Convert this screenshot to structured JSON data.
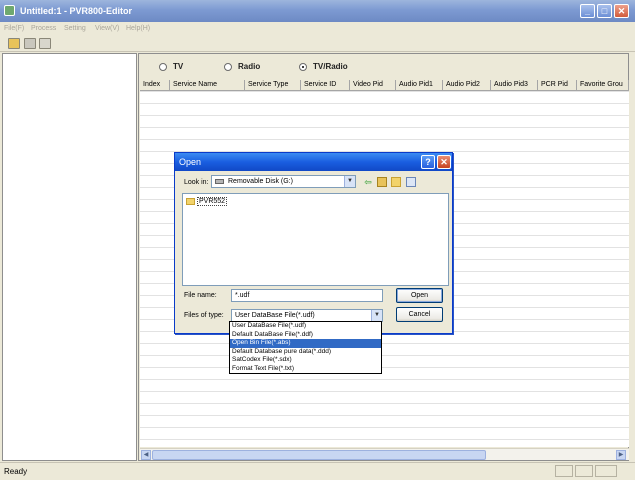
{
  "window": {
    "title": "Untitled:1 - PVR800-Editor",
    "minimize": "_",
    "maximize": "□",
    "close": "✕"
  },
  "menu": [
    "File(F)",
    "Process",
    "Setting",
    "View(V)",
    "Help(H)"
  ],
  "toolbar": {
    "icons": [
      "open-folder-icon",
      "save-disk-icon",
      "print-icon"
    ]
  },
  "modes": {
    "options": [
      "TV",
      "Radio",
      "TV/Radio"
    ],
    "selected": "TV/Radio"
  },
  "table": {
    "columns": [
      "Index",
      "Service Name",
      "Service Type",
      "Service ID",
      "Video Pid",
      "Audio Pid1",
      "Audio Pid2",
      "Audio Pid3",
      "PCR Pid",
      "Favorite Grou"
    ]
  },
  "status": {
    "text": "Ready"
  },
  "dialog": {
    "title": "Open",
    "help": "?",
    "close": "✕",
    "look_in_label": "Look in:",
    "look_in_value": "Removable Disk (G:)",
    "files": [
      "PVR552"
    ],
    "file_name_label": "File name:",
    "file_name_value": "*.udf",
    "file_type_label": "Files of type:",
    "file_type_value": "User DataBase File(*.udf)",
    "open_label": "Open",
    "cancel_label": "Cancel",
    "file_type_options": [
      "User DataBase File(*.udf)",
      "Default DataBase File(*.ddf)",
      "Open Bin File(*.abs)",
      "Default Database pure data(*.ddd)",
      "SatCodex File(*.sdx)",
      "Format Text File(*.txt)"
    ],
    "highlighted_option": "Open Bin File(*.abs)"
  },
  "colors": {
    "titlebar_inactive": "#7d9ad2",
    "dialog_titlebar": "#1a5ee0",
    "selection": "#316ac5"
  }
}
